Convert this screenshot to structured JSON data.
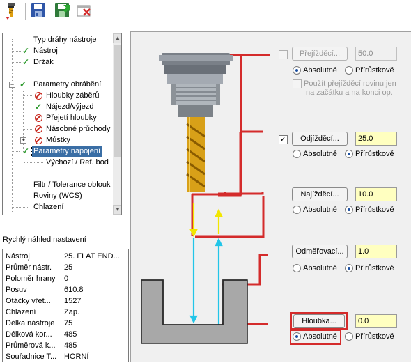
{
  "tree": {
    "items": [
      {
        "label": "Typ dráhy nástroje",
        "status": "none"
      },
      {
        "label": "Nástroj",
        "status": "check"
      },
      {
        "label": "Držák",
        "status": "check"
      },
      {
        "label": "",
        "status": "none"
      },
      {
        "label": "Parametry obrábění",
        "status": "check"
      },
      {
        "label": "Hloubky záběrů",
        "status": "no"
      },
      {
        "label": "Nájezd/výjezd",
        "status": "check"
      },
      {
        "label": "Přejetí hloubky",
        "status": "no"
      },
      {
        "label": "Násobné průchody",
        "status": "no"
      },
      {
        "label": "Můstky",
        "status": "no"
      },
      {
        "label": "Parametry napojení",
        "status": "check"
      },
      {
        "label": "Výchozí / Ref. bod",
        "status": "none"
      },
      {
        "label": "",
        "status": "none"
      },
      {
        "label": "Filtr / Tolerance oblouk",
        "status": "none"
      },
      {
        "label": "Roviny (WCS)",
        "status": "none"
      },
      {
        "label": "Chlazení",
        "status": "none"
      },
      {
        "label": "",
        "status": "none"
      }
    ],
    "selected_index": 10
  },
  "preview": {
    "title": "Rychlý náhled nastavení",
    "rows": [
      {
        "key": "Nástroj",
        "value": "25. FLAT END..."
      },
      {
        "key": "Průměr nástr.",
        "value": "25"
      },
      {
        "key": "Poloměr hrany",
        "value": "0"
      },
      {
        "key": "Posuv",
        "value": "610.8"
      },
      {
        "key": "Otáčky vřet...",
        "value": "1527"
      },
      {
        "key": "Chlazení",
        "value": "Zap."
      },
      {
        "key": "Délka nástroje",
        "value": "75"
      },
      {
        "key": "Délková kor...",
        "value": "485"
      },
      {
        "key": "Průměrová k...",
        "value": "485"
      },
      {
        "key": "Souřadnice T...",
        "value": "HORNÍ"
      }
    ]
  },
  "params": {
    "clearance": {
      "button": "Přejížděcí...",
      "value": "50.0",
      "enabled": false,
      "abs_label": "Absolutně",
      "inc_label": "Přírůstkově",
      "mode": "absolute",
      "note_line1": "Použít přejížděcí rovinu jen",
      "note_line2": "na začátku a na konci op."
    },
    "retract": {
      "button": "Odjížděcí...",
      "value": "25.0",
      "enabled": true,
      "abs_label": "Absolutně",
      "inc_label": "Přírůstkově",
      "mode": "incremental"
    },
    "feed_plane": {
      "button": "Najížděcí...",
      "value": "10.0",
      "abs_label": "Absolutně",
      "inc_label": "Přírůstkově",
      "mode": "incremental"
    },
    "top_of_stock": {
      "button": "Odměřovací...",
      "value": "1.0",
      "abs_label": "Absolutně",
      "inc_label": "Přírůstkově",
      "mode": "incremental"
    },
    "depth": {
      "button": "Hloubka...",
      "value": "0.0",
      "abs_label": "Absolutně",
      "inc_label": "Přírůstkově",
      "mode": "absolute"
    }
  },
  "icons": {
    "toolbar": [
      "tool-icon",
      "save-icon",
      "save-as-icon",
      "delete-icon"
    ]
  },
  "colors": {
    "accent_red": "#d42b2b",
    "move_yellow": "#f2e600",
    "move_cyan": "#22c5e8",
    "field_yellow": "#ffffc0",
    "selection_blue": "#3a6ea5"
  }
}
